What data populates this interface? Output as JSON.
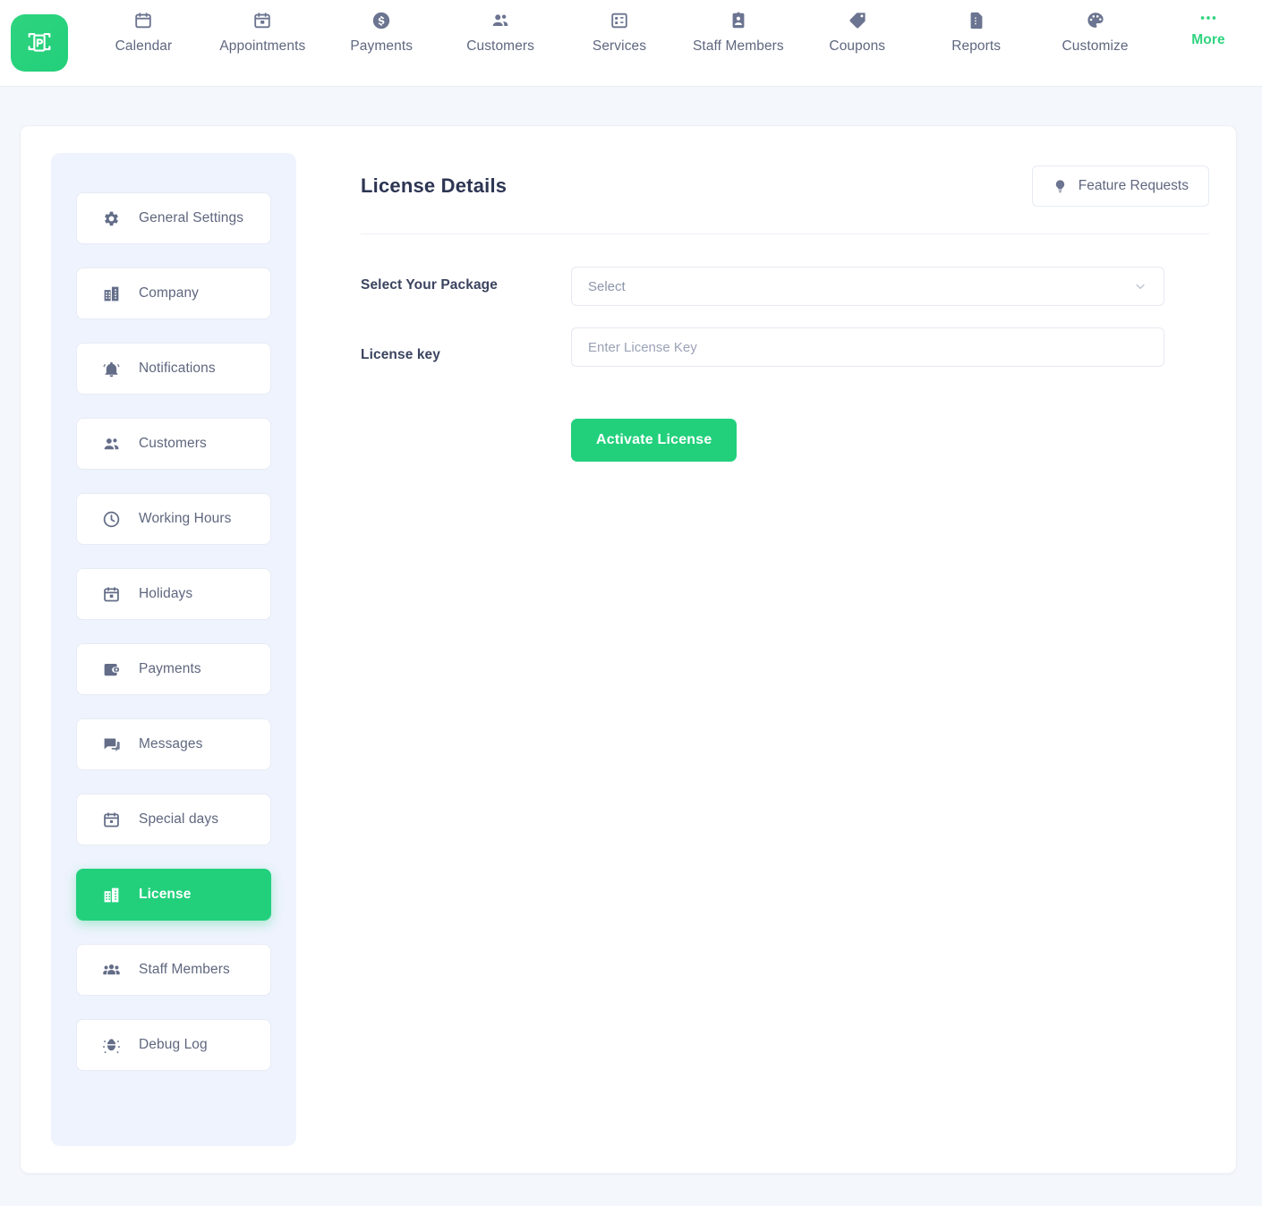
{
  "brand": {
    "logo_icon": "bookly-logo-icon",
    "accent_color": "#22d07c"
  },
  "topnav": {
    "items": [
      {
        "label": "Calendar",
        "icon": "calendar-icon"
      },
      {
        "label": "Appointments",
        "icon": "calendar-event-icon"
      },
      {
        "label": "Payments",
        "icon": "dollar-coin-icon"
      },
      {
        "label": "Customers",
        "icon": "people-icon"
      },
      {
        "label": "Services",
        "icon": "services-grid-icon"
      },
      {
        "label": "Staff Members",
        "icon": "id-badge-icon"
      },
      {
        "label": "Coupons",
        "icon": "tag-icon"
      },
      {
        "label": "Reports",
        "icon": "report-document-icon"
      },
      {
        "label": "Customize",
        "icon": "palette-icon"
      }
    ],
    "more": {
      "label": "More",
      "icon": "ellipsis-icon"
    }
  },
  "sidebar": {
    "items": [
      {
        "label": "General Settings",
        "icon": "gear-icon",
        "active": false
      },
      {
        "label": "Company",
        "icon": "building-icon",
        "active": false
      },
      {
        "label": "Notifications",
        "icon": "bell-icon",
        "active": false
      },
      {
        "label": "Customers",
        "icon": "people-icon",
        "active": false
      },
      {
        "label": "Working Hours",
        "icon": "clock-icon",
        "active": false
      },
      {
        "label": "Holidays",
        "icon": "calendar-event-icon",
        "active": false
      },
      {
        "label": "Payments",
        "icon": "wallet-icon",
        "active": false
      },
      {
        "label": "Messages",
        "icon": "chat-bubbles-icon",
        "active": false
      },
      {
        "label": "Special days",
        "icon": "calendar-star-icon",
        "active": false
      },
      {
        "label": "License",
        "icon": "building-icon",
        "active": true
      },
      {
        "label": "Staff Members",
        "icon": "group-people-icon",
        "active": false
      },
      {
        "label": "Debug Log",
        "icon": "bug-icon",
        "active": false
      }
    ]
  },
  "main": {
    "title": "License Details",
    "feature_requests": {
      "label": "Feature Requests",
      "icon": "lightbulb-icon"
    },
    "form": {
      "package": {
        "label": "Select Your Package",
        "value": "Select",
        "chevron_icon": "chevron-down-icon"
      },
      "license_key": {
        "label": "License key",
        "value": "",
        "placeholder": "Enter License Key"
      }
    },
    "activate_button": "Activate License"
  }
}
